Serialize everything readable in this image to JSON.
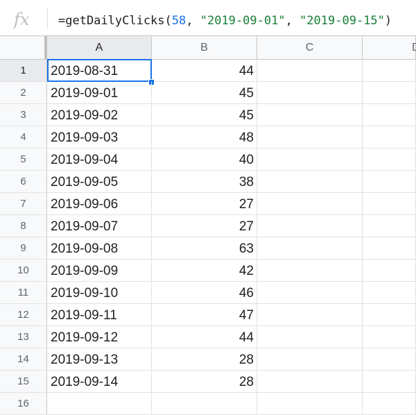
{
  "formula_bar": {
    "fx_label": "fx",
    "func_name": "=getDailyClicks(",
    "arg_number": "58",
    "sep1": ", ",
    "arg_start": "\"2019-09-01\"",
    "sep2": ", ",
    "arg_end": "\"2019-09-15\"",
    "close": ")"
  },
  "columns": [
    "A",
    "B",
    "C",
    "D"
  ],
  "selected_cell": "A1",
  "rows": [
    {
      "num": "1",
      "a": "2019-08-31",
      "b": "44"
    },
    {
      "num": "2",
      "a": "2019-09-01",
      "b": "45"
    },
    {
      "num": "3",
      "a": "2019-09-02",
      "b": "45"
    },
    {
      "num": "4",
      "a": "2019-09-03",
      "b": "48"
    },
    {
      "num": "5",
      "a": "2019-09-04",
      "b": "40"
    },
    {
      "num": "6",
      "a": "2019-09-05",
      "b": "38"
    },
    {
      "num": "7",
      "a": "2019-09-06",
      "b": "27"
    },
    {
      "num": "8",
      "a": "2019-09-07",
      "b": "27"
    },
    {
      "num": "9",
      "a": "2019-09-08",
      "b": "63"
    },
    {
      "num": "10",
      "a": "2019-09-09",
      "b": "42"
    },
    {
      "num": "11",
      "a": "2019-09-10",
      "b": "46"
    },
    {
      "num": "12",
      "a": "2019-09-11",
      "b": "47"
    },
    {
      "num": "13",
      "a": "2019-09-12",
      "b": "44"
    },
    {
      "num": "14",
      "a": "2019-09-13",
      "b": "28"
    },
    {
      "num": "15",
      "a": "2019-09-14",
      "b": "28"
    },
    {
      "num": "16",
      "a": "",
      "b": ""
    }
  ],
  "colors": {
    "selection": "#1a73e8",
    "header_bg": "#f8f9fa",
    "number_token": "#1a73e8",
    "string_token": "#188038"
  }
}
